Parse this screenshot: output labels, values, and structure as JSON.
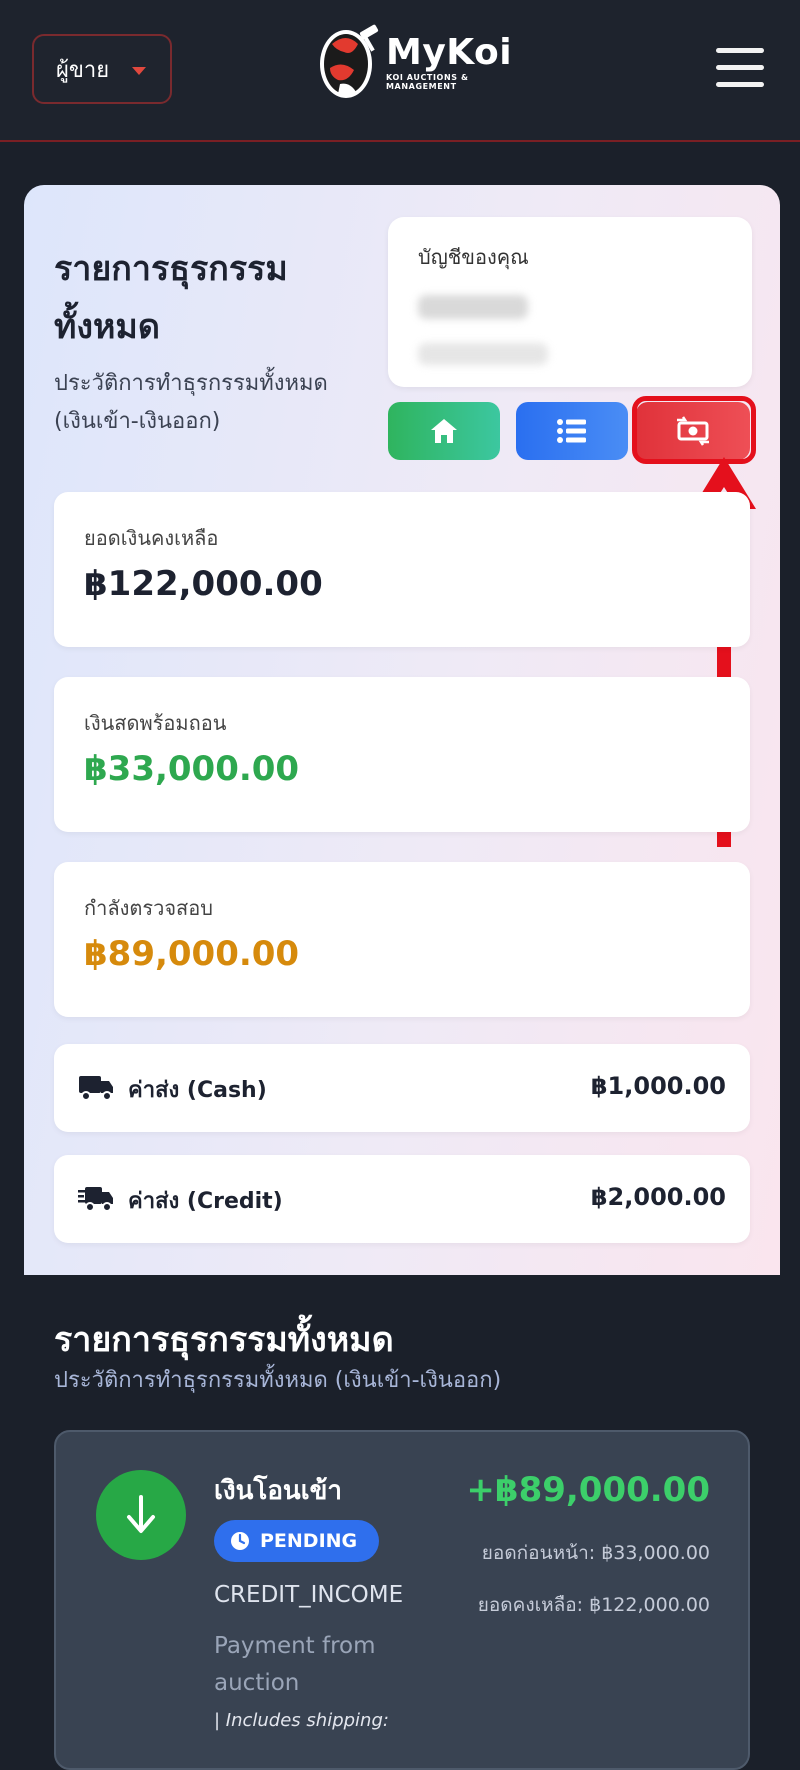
{
  "header": {
    "role_select": "ผู้ขาย",
    "logo_name": "MyKoi",
    "logo_sub": "KOI AUCTIONS & MANAGEMENT"
  },
  "hero": {
    "title": "รายการธุรกรรมทั้งหมด",
    "subtitle": "ประวัติการทำธุรกรรมทั้งหมด (เงินเข้า-เงินออก)",
    "account_label": "บัญชีของคุณ"
  },
  "balances": [
    {
      "label": "ยอดเงินคงเหลือ",
      "value": "฿122,000.00",
      "color": "#1d2230"
    },
    {
      "label": "เงินสดพร้อมถอน",
      "value": "฿33,000.00",
      "color": "#2ea84f"
    },
    {
      "label": "กำลังตรวจสอบ",
      "value": "฿89,000.00",
      "color": "#d68a0c"
    }
  ],
  "shipping": [
    {
      "label": "ค่าส่ง (Cash)",
      "amount": "฿1,000.00",
      "icon": "truck-icon"
    },
    {
      "label": "ค่าส่ง (Credit)",
      "amount": "฿2,000.00",
      "icon": "fast-truck-icon"
    }
  ],
  "transactions_section": {
    "title": "รายการธุรกรรมทั้งหมด",
    "subtitle": "ประวัติการทำธุรกรรมทั้งหมด (เงินเข้า-เงินออก)"
  },
  "transaction": {
    "title": "เงินโอนเข้า",
    "status": "PENDING",
    "type": "CREDIT_INCOME",
    "description": "Payment from auction",
    "note": "| Includes shipping:",
    "amount": "+฿89,000.00",
    "balance_before": "ยอดก่อนหน้า: ฿33,000.00",
    "balance_after": "ยอดคงเหลือ: ฿122,000.00"
  },
  "colors": {
    "accent_red": "#e4101c",
    "green": "#2fb45e",
    "blue": "#2f6fed"
  }
}
